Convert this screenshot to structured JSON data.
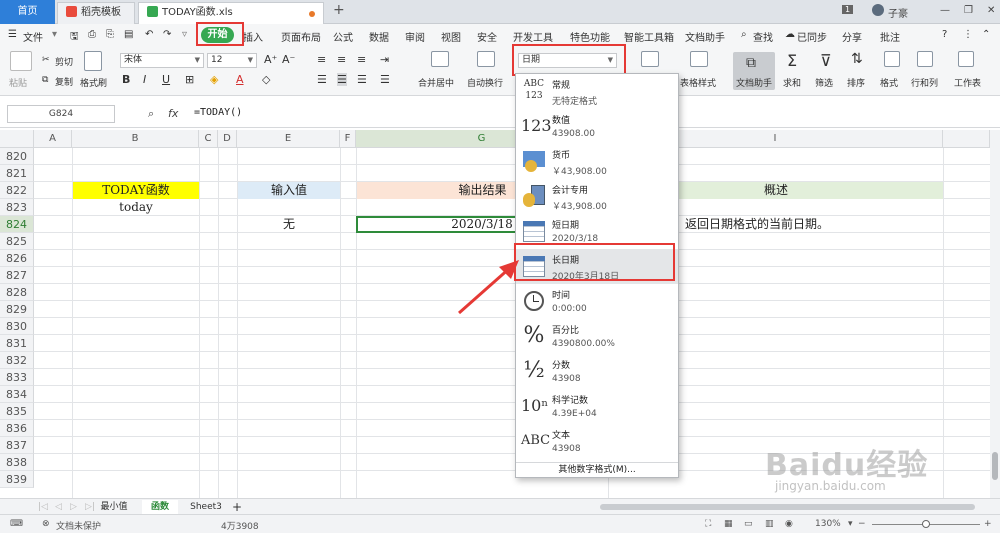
{
  "tabs": {
    "home": "首页",
    "templates": "稻壳模板",
    "file": "TODAY函数.xls"
  },
  "window": {
    "badge": "1",
    "user": "子豪"
  },
  "menu": {
    "file": "文件",
    "items": [
      "开始",
      "插入",
      "页面布局",
      "公式",
      "数据",
      "审阅",
      "视图",
      "安全",
      "开发工具",
      "特色功能",
      "智能工具箱",
      "文档助手"
    ],
    "search": "查找",
    "sync": "已同步",
    "share": "分享",
    "comment": "批注",
    "help": "?"
  },
  "ribbon": {
    "paste": "粘贴",
    "cut": "剪切",
    "copy": "复制",
    "format_painter": "格式刷",
    "font": "宋体",
    "font_size": "12",
    "bold": "B",
    "italic": "I",
    "underline": "U",
    "merge": "合并居中",
    "wrap": "自动换行",
    "number_format": "日期",
    "table_style": "表格样式",
    "doc_assistant": "文档助手",
    "sum": "求和",
    "filter": "筛选",
    "sort": "排序",
    "format": "格式",
    "rowcol": "行和列",
    "worksheet": "工作表"
  },
  "formula_bar": {
    "cell_ref": "G824",
    "formula": "=TODAY()"
  },
  "columns": [
    "A",
    "B",
    "C",
    "D",
    "E",
    "F",
    "G",
    "I"
  ],
  "rows": [
    "820",
    "821",
    "822",
    "823",
    "824",
    "825",
    "826",
    "827",
    "828",
    "829",
    "830",
    "831",
    "832",
    "833",
    "834",
    "835",
    "836",
    "837",
    "838",
    "839"
  ],
  "cells": {
    "b822": "TODAY函数",
    "b823": "today",
    "e822": "输入值",
    "e824": "无",
    "g822": "输出结果",
    "g824": "2020/3/18",
    "i822": "概述",
    "i824": "返回日期格式的当前日期。"
  },
  "sheets": [
    "最小值",
    "函数",
    "Sheet3"
  ],
  "status": {
    "protect": "文档未保护",
    "value": "4万3908",
    "zoom": "130%"
  },
  "dropdown": {
    "items": [
      {
        "icon": "ABC 123",
        "name": "常规",
        "sample": "无特定格式"
      },
      {
        "icon": "123",
        "name": "数值",
        "sample": "43908.00"
      },
      {
        "icon": "currency-icon",
        "name": "货币",
        "sample": "￥43,908.00"
      },
      {
        "icon": "accounting-icon",
        "name": "会计专用",
        "sample": "￥43,908.00"
      },
      {
        "icon": "calendar-icon",
        "name": "短日期",
        "sample": "2020/3/18"
      },
      {
        "icon": "calendar-icon",
        "name": "长日期",
        "sample": "2020年3月18日"
      },
      {
        "icon": "clock-icon",
        "name": "时间",
        "sample": "0:00:00"
      },
      {
        "icon": "%",
        "name": "百分比",
        "sample": "4390800.00%"
      },
      {
        "icon": "½",
        "name": "分数",
        "sample": "43908"
      },
      {
        "icon": "10ⁿ",
        "name": "科学记数",
        "sample": "4.39E+04"
      },
      {
        "icon": "ABC",
        "name": "文本",
        "sample": "43908"
      }
    ],
    "footer": "其他数字格式(M)..."
  },
  "watermark": {
    "main": "Baidu经验",
    "sub": "jingyan.baidu.com"
  },
  "colors": {
    "accent": "#36a852",
    "highlight_red": "#e53935",
    "yellow": "#ffff00",
    "blue_cell": "#ddebf7",
    "peach_cell": "#fce4d6",
    "green_cell": "#e2efda"
  }
}
